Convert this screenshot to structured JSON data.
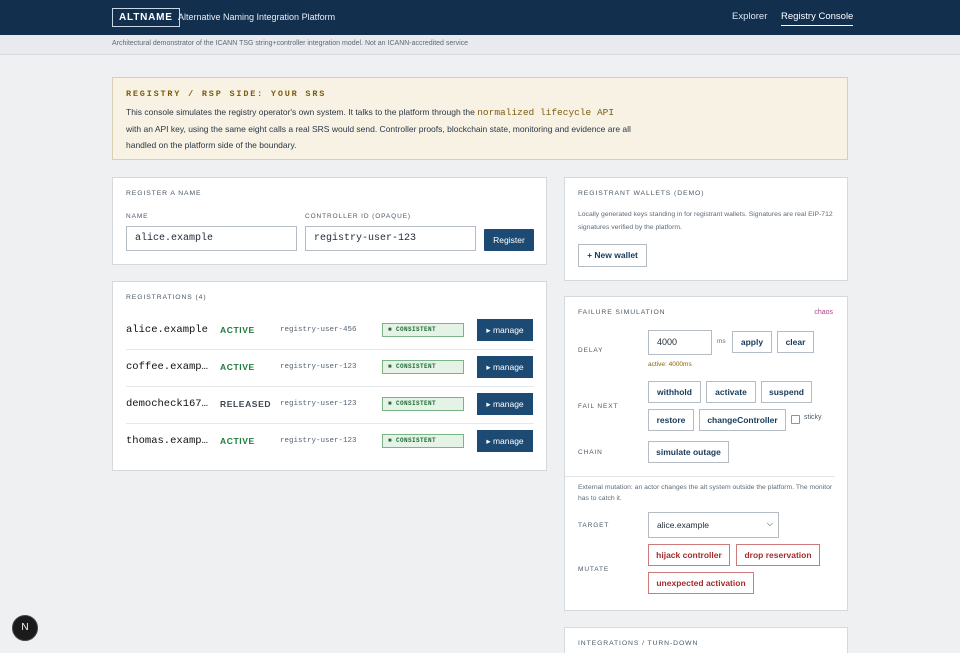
{
  "header": {
    "logo": "ALTNAME",
    "subtitle": "Alternative Naming Integration Platform",
    "nav": [
      "Explorer",
      "Registry Console"
    ]
  },
  "disclaimer": "Architectural demonstrator of the ICANN TSG string+controller integration model. Not an ICANN-accredited service",
  "notice": {
    "title": "REGISTRY / RSP SIDE: YOUR SRS",
    "text_before": "This console simulates the registry operator's own system. It talks to the platform through the ",
    "code": "normalized lifecycle API",
    "text_after": "with an API key, using the same eight calls a real SRS would send. Controller proofs, blockchain state, monitoring and evidence are all handled on the platform side of the boundary."
  },
  "register": {
    "title": "REGISTER A NAME",
    "name_label": "NAME",
    "name_value": "alice.example",
    "controller_label": "CONTROLLER ID (OPAQUE)",
    "controller_value": "registry-user-123",
    "button": "Register"
  },
  "registrations": {
    "title": "REGISTRATIONS (4)",
    "badge": "■ CONSISTENT",
    "manage_label": "▸ manage",
    "rows": [
      {
        "name": "alice.example",
        "status": "ACTIVE",
        "controller": "registry-user-456"
      },
      {
        "name": "coffee.example",
        "status": "ACTIVE",
        "controller": "registry-user-123"
      },
      {
        "name": "democheck1675…",
        "status": "RELEASED",
        "controller": "registry-user-123"
      },
      {
        "name": "thomas.example",
        "status": "ACTIVE",
        "controller": "registry-user-123"
      }
    ]
  },
  "wallets": {
    "title": "REGISTRANT WALLETS (DEMO)",
    "note": "Locally generated keys standing in for registrant wallets. Signatures are real EIP-712 signatures verified by the platform.",
    "button": "+ New wallet"
  },
  "failure": {
    "title": "FAILURE SIMULATION",
    "chaos": "chaos",
    "delay_label": "DELAY",
    "delay_value": "4000",
    "delay_unit": "ms",
    "apply": "apply",
    "clear": "clear",
    "active_delay": "active: 4000ms",
    "fail_next_label": "FAIL NEXT",
    "fail_buttons": [
      "withhold",
      "activate",
      "suspend",
      "restore",
      "changeController"
    ],
    "sticky": "sticky",
    "chain_label": "CHAIN",
    "chain_button": "simulate outage",
    "external_note": "External mutation: an actor changes the alt system outside the platform. The monitor has to catch it.",
    "target_label": "TARGET",
    "target_value": "alice.example",
    "mutate_label": "MUTATE",
    "mutate_buttons": [
      "hijack controller",
      "drop reservation",
      "unexpected activation"
    ]
  },
  "integrations": {
    "title": "INTEGRATIONS / TURN-DOWN"
  },
  "fab_label": "N"
}
